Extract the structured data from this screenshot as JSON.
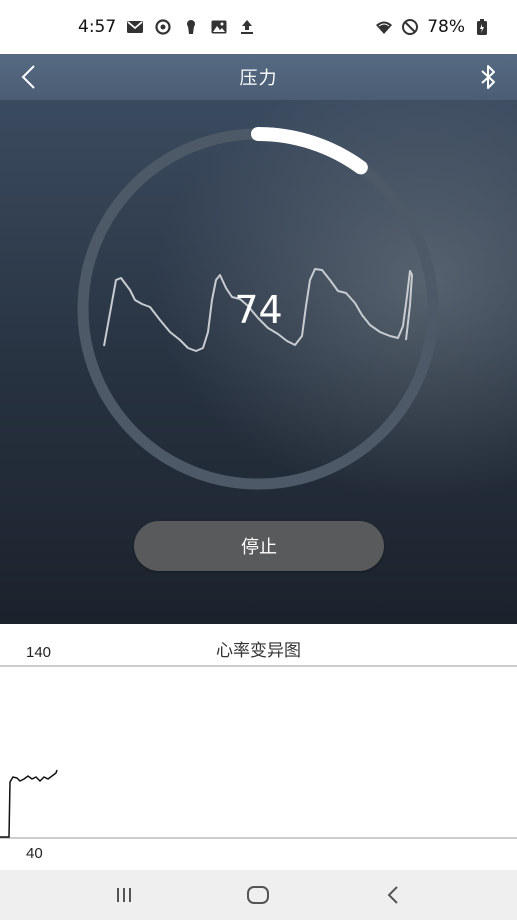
{
  "status_bar": {
    "time": "4:57",
    "left_icons": [
      "gmail-icon",
      "sync-icon",
      "keyhole-icon",
      "image-icon",
      "upload-icon"
    ],
    "right_icons": [
      "wifi-icon",
      "do-not-disturb-icon",
      "battery-icon"
    ],
    "battery": "78%"
  },
  "app_bar": {
    "title": "压力",
    "back_icon": "chevron-left-icon",
    "bluetooth_icon": "bluetooth-icon",
    "color": "#566a83"
  },
  "gauge": {
    "value": "74",
    "progress_fraction": 0.1,
    "track_color": "#4d5966",
    "progress_color": "#ffffff"
  },
  "stop_button": {
    "label": "停止"
  },
  "hrv_chart": {
    "title": "心率变异图",
    "y_max_label": "140",
    "y_min_label": "40"
  },
  "nav_bar": {
    "icons": [
      "recent-apps-icon",
      "home-icon",
      "back-icon"
    ]
  }
}
